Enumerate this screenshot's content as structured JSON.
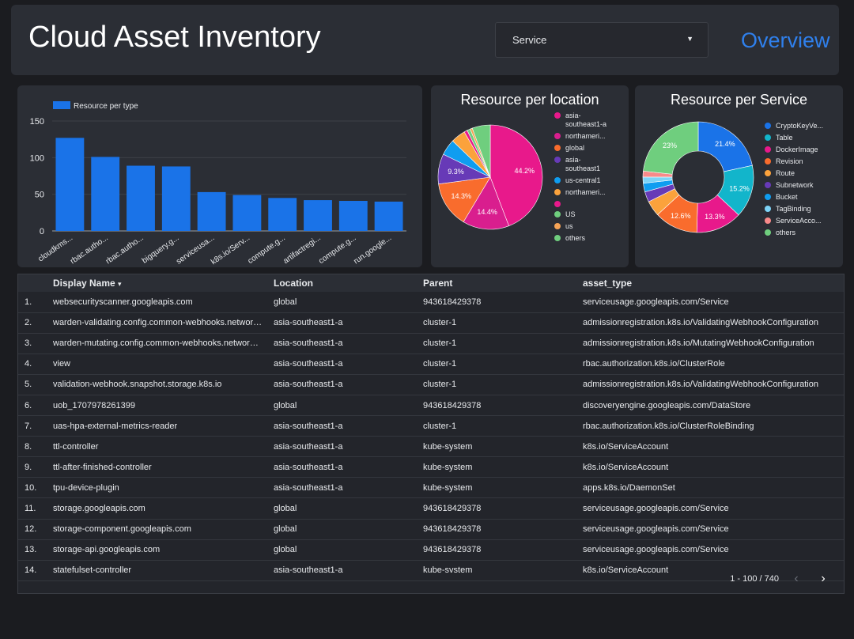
{
  "header": {
    "title": "Cloud Asset Inventory",
    "dropdown_label": "Service",
    "nav_link": "Overview"
  },
  "colors": {
    "blue": "#1a73e8",
    "teal": "#12b5cb",
    "pink": "#e8198b",
    "orange": "#f96c2d",
    "light_orange": "#fba23c",
    "purple": "#673ab7",
    "sky": "#0f9df0",
    "light_blue": "#7dd4f8",
    "green": "#6fce7e",
    "tan": "#f6a356",
    "magenta": "#d91e8e",
    "salmon": "#f88a8a"
  },
  "charts": {
    "bar": {
      "type": "bar",
      "legend": "Resource per type",
      "categories": [
        "cloudkms...",
        "rbac.autho...",
        "rbac.autho...",
        "bigquery.g...",
        "serviceusa...",
        "k8s.io/Serv...",
        "compute.g...",
        "artifactregi...",
        "compute.g...",
        "run.google..."
      ],
      "values": [
        127,
        101,
        89,
        88,
        53,
        49,
        45,
        42,
        41,
        40
      ],
      "ylim": [
        0,
        150
      ],
      "yticks": [
        0,
        50,
        100,
        150
      ],
      "color": "#1a73e8"
    },
    "location": {
      "type": "pie",
      "title": "Resource per location",
      "slices": [
        {
          "label": "asia-southeast1-a",
          "value": 44.2,
          "color": "#e8198b"
        },
        {
          "label": "northameri...",
          "value": 14.4,
          "color": "#d91e8e"
        },
        {
          "label": "global",
          "value": 14.3,
          "color": "#f96c2d"
        },
        {
          "label": "asia-southeast1",
          "value": 9.3,
          "color": "#673ab7"
        },
        {
          "label": "us-central1",
          "value": 5.0,
          "color": "#0f9df0"
        },
        {
          "label": "northameri...",
          "value": 4.5,
          "color": "#fba23c"
        },
        {
          "label": "",
          "value": 1.0,
          "color": "#e8198b"
        },
        {
          "label": "US",
          "value": 1.0,
          "color": "#6fce7e"
        },
        {
          "label": "us",
          "value": 0.7,
          "color": "#f6a356"
        },
        {
          "label": "others",
          "value": 5.6,
          "color": "#6fce7e"
        }
      ],
      "legend": [
        {
          "label": "asia-",
          "label2": "southeast1-a",
          "color": "#e8198b"
        },
        {
          "label": "northameri...",
          "color": "#d91e8e"
        },
        {
          "label": "global",
          "color": "#f96c2d"
        },
        {
          "label": "asia-",
          "label2": "southeast1",
          "color": "#673ab7"
        },
        {
          "label": "us-central1",
          "color": "#0f9df0"
        },
        {
          "label": "northameri...",
          "color": "#fba23c"
        },
        {
          "label": "",
          "color": "#e8198b"
        },
        {
          "label": "US",
          "color": "#6fce7e"
        },
        {
          "label": "us",
          "color": "#f6a356"
        },
        {
          "label": "others",
          "color": "#6fce7e"
        }
      ]
    },
    "service": {
      "type": "donut",
      "title": "Resource per Service",
      "slices": [
        {
          "label": "CryptoKeyVe...",
          "value": 21.4,
          "color": "#1a73e8"
        },
        {
          "label": "Table",
          "value": 15.2,
          "color": "#12b5cb"
        },
        {
          "label": "DockerImage",
          "value": 13.3,
          "color": "#e8198b"
        },
        {
          "label": "Revision",
          "value": 12.6,
          "color": "#f96c2d"
        },
        {
          "label": "Route",
          "value": 4.5,
          "color": "#fba23c"
        },
        {
          "label": "Subnetwork",
          "value": 3.0,
          "color": "#673ab7"
        },
        {
          "label": "Bucket",
          "value": 2.5,
          "color": "#0f9df0"
        },
        {
          "label": "TagBinding",
          "value": 1.8,
          "color": "#7dd4f8"
        },
        {
          "label": "ServiceAcco...",
          "value": 1.7,
          "color": "#f88a8a"
        },
        {
          "label": "others",
          "value": 23.0,
          "color": "#6fce7e"
        }
      ]
    }
  },
  "chart_data": [
    {
      "type": "bar",
      "categories": [
        "cloudkms...",
        "rbac.autho...",
        "rbac.autho...",
        "bigquery.g...",
        "serviceusa...",
        "k8s.io/Serv...",
        "compute.g...",
        "artifactregi...",
        "compute.g...",
        "run.google..."
      ],
      "series": [
        {
          "name": "Resource per type",
          "values": [
            127,
            101,
            89,
            88,
            53,
            49,
            45,
            42,
            41,
            40
          ]
        }
      ],
      "ylim": [
        0,
        150
      ]
    },
    {
      "type": "pie",
      "title": "Resource per location",
      "labels": [
        "asia-southeast1-a",
        "northameri...",
        "global",
        "asia-southeast1",
        "us-central1",
        "northameri...",
        "",
        "US",
        "us",
        "others"
      ],
      "values": [
        44.2,
        14.4,
        14.3,
        9.3,
        5.0,
        4.5,
        1.0,
        1.0,
        0.7,
        5.6
      ]
    },
    {
      "type": "pie",
      "title": "Resource per Service",
      "labels": [
        "CryptoKeyVe...",
        "Table",
        "DockerImage",
        "Revision",
        "Route",
        "Subnetwork",
        "Bucket",
        "TagBinding",
        "ServiceAcco...",
        "others"
      ],
      "values": [
        21.4,
        15.2,
        13.3,
        12.6,
        4.5,
        3.0,
        2.5,
        1.8,
        1.7,
        23.0
      ]
    }
  ],
  "table": {
    "headers": [
      "Display Name",
      "Location",
      "Parent",
      "asset_type"
    ],
    "sort_indicator": "▾",
    "rows": [
      [
        "1.",
        "websecurityscanner.googleapis.com",
        "global",
        "943618429378",
        "serviceusage.googleapis.com/Service"
      ],
      [
        "2.",
        "warden-validating.config.common-webhooks.networ…",
        "asia-southeast1-a",
        "cluster-1",
        "admissionregistration.k8s.io/ValidatingWebhookConfiguration"
      ],
      [
        "3.",
        "warden-mutating.config.common-webhooks.networ…",
        "asia-southeast1-a",
        "cluster-1",
        "admissionregistration.k8s.io/MutatingWebhookConfiguration"
      ],
      [
        "4.",
        "view",
        "asia-southeast1-a",
        "cluster-1",
        "rbac.authorization.k8s.io/ClusterRole"
      ],
      [
        "5.",
        "validation-webhook.snapshot.storage.k8s.io",
        "asia-southeast1-a",
        "cluster-1",
        "admissionregistration.k8s.io/ValidatingWebhookConfiguration"
      ],
      [
        "6.",
        "uob_1707978261399",
        "global",
        "943618429378",
        "discoveryengine.googleapis.com/DataStore"
      ],
      [
        "7.",
        "uas-hpa-external-metrics-reader",
        "asia-southeast1-a",
        "cluster-1",
        "rbac.authorization.k8s.io/ClusterRoleBinding"
      ],
      [
        "8.",
        "ttl-controller",
        "asia-southeast1-a",
        "kube-system",
        "k8s.io/ServiceAccount"
      ],
      [
        "9.",
        "ttl-after-finished-controller",
        "asia-southeast1-a",
        "kube-system",
        "k8s.io/ServiceAccount"
      ],
      [
        "10.",
        "tpu-device-plugin",
        "asia-southeast1-a",
        "kube-system",
        "apps.k8s.io/DaemonSet"
      ],
      [
        "11.",
        "storage.googleapis.com",
        "global",
        "943618429378",
        "serviceusage.googleapis.com/Service"
      ],
      [
        "12.",
        "storage-component.googleapis.com",
        "global",
        "943618429378",
        "serviceusage.googleapis.com/Service"
      ],
      [
        "13.",
        "storage-api.googleapis.com",
        "global",
        "943618429378",
        "serviceusage.googleapis.com/Service"
      ],
      [
        "14.",
        "statefulset-controller",
        "asia-southeast1-a",
        "kube-svstem",
        "k8s.io/ServiceAccount"
      ]
    ],
    "pagination": "1 - 100 / 740"
  }
}
